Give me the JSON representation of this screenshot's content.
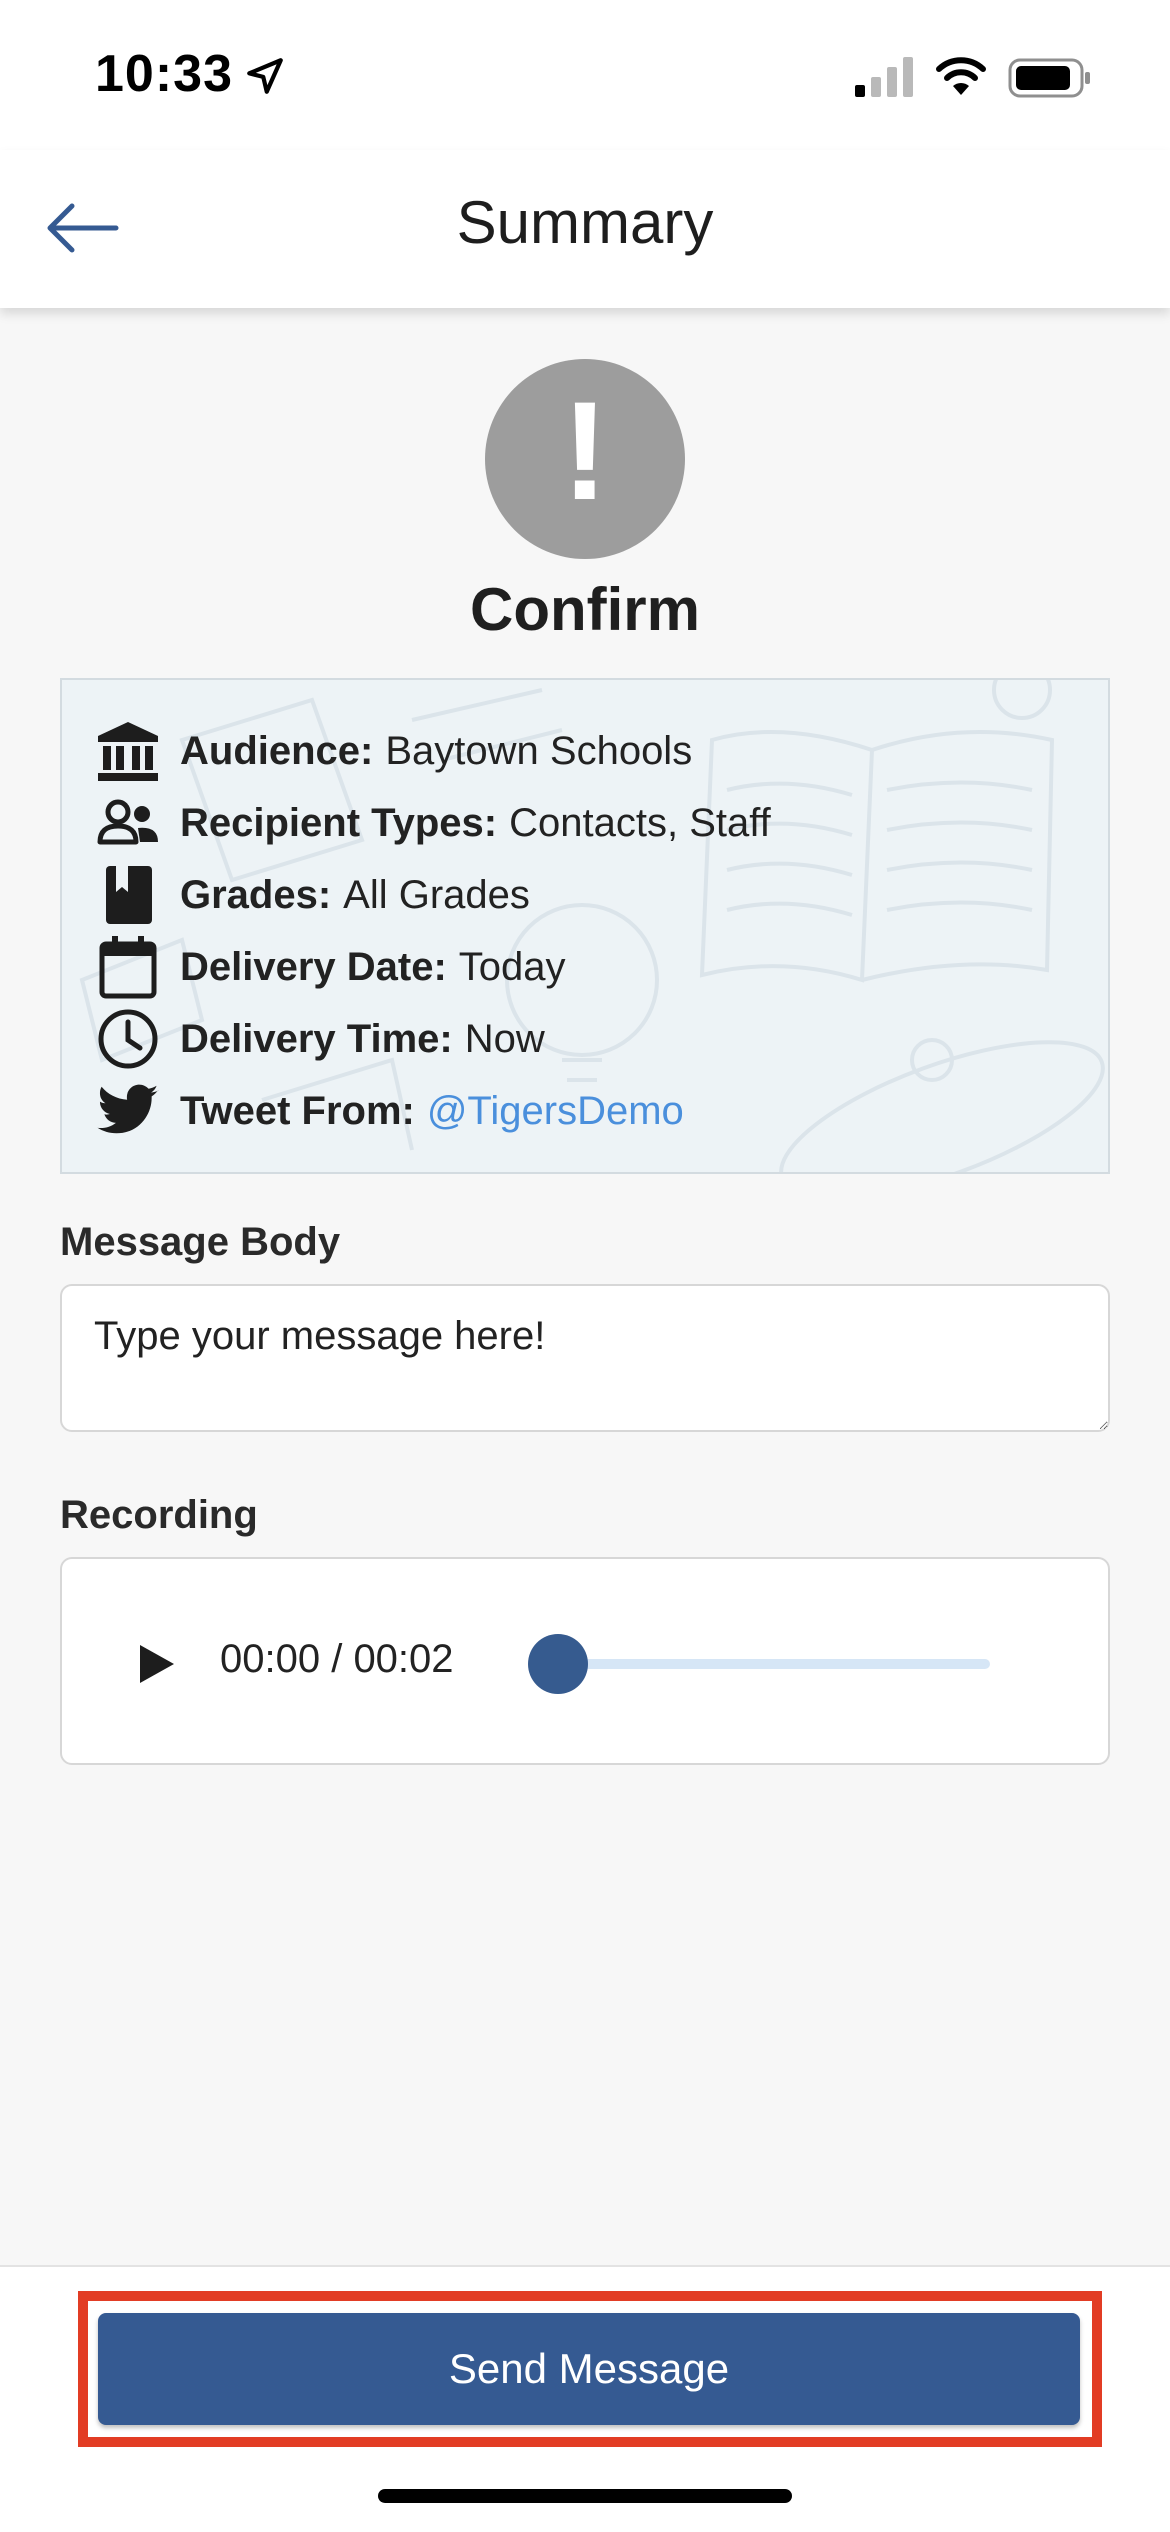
{
  "status_bar": {
    "time": "10:33",
    "icons": [
      "location-arrow-icon",
      "signal-icon",
      "wifi-icon",
      "battery-icon"
    ]
  },
  "header": {
    "title": "Summary",
    "back_icon": "arrow-left-icon"
  },
  "alert": {
    "symbol": "!",
    "title": "Confirm"
  },
  "summary": {
    "rows": [
      {
        "icon": "institution-icon",
        "label": "Audience:",
        "value": "Baytown Schools"
      },
      {
        "icon": "users-icon",
        "label": "Recipient Types:",
        "value": "Contacts, Staff"
      },
      {
        "icon": "book-icon",
        "label": "Grades:",
        "value": "All Grades"
      },
      {
        "icon": "calendar-icon",
        "label": "Delivery Date:",
        "value": "Today"
      },
      {
        "icon": "clock-icon",
        "label": "Delivery Time:",
        "value": "Now"
      },
      {
        "icon": "twitter-icon",
        "label": "Tweet From:",
        "value": "@TigersDemo"
      }
    ]
  },
  "message_body": {
    "label": "Message Body",
    "placeholder": "Type your message here!"
  },
  "recording": {
    "label": "Recording",
    "time": "00:00 / 00:02",
    "progress": 0
  },
  "footer": {
    "send_label": "Send Message"
  },
  "colors": {
    "primary": "#355a92",
    "link": "#4a8fdc",
    "highlight": "#e23c24",
    "alert_gray": "#9d9d9d"
  }
}
